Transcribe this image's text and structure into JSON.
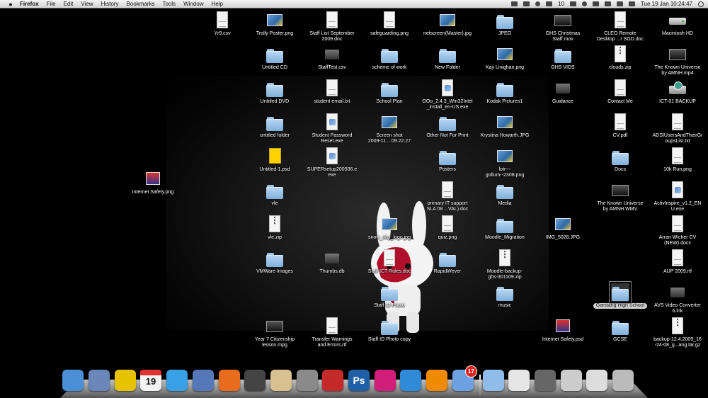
{
  "menubar": {
    "app_name": "Firefox",
    "menus": [
      "File",
      "Edit",
      "View",
      "History",
      "Bookmarks",
      "Tools",
      "Window",
      "Help"
    ],
    "status": {
      "badge_count": "10",
      "clock": "Tue 19 Jan  10:24:47"
    }
  },
  "desktop": {
    "items": [
      {
        "label": "Yr9.csv",
        "type": "doc"
      },
      {
        "label": "Trolly Poster.png",
        "type": "image"
      },
      {
        "label": "Staff List September\n2009.doc",
        "type": "doc"
      },
      {
        "label": "safeguarding.png",
        "type": "doc"
      },
      {
        "label": "netscreen(Master).jpg",
        "type": "image"
      },
      {
        "label": "JPEG",
        "type": "folder"
      },
      {
        "label": "GHS Christmas\nStaff.mov",
        "type": "video"
      },
      {
        "label": "CLEO Remote\nDesktop ...r SGD.doc",
        "type": "doc"
      },
      {
        "label": "Macintosh HD",
        "type": "drive"
      },
      {
        "label": "Untitled CD",
        "type": "folder"
      },
      {
        "label": "StaffTest.csv",
        "type": "dark"
      },
      {
        "label": "scheme of work",
        "type": "folder"
      },
      {
        "label": "New Folder",
        "type": "folder"
      },
      {
        "label": "Kay Linighan.png",
        "type": "image"
      },
      {
        "label": "GHS VIDS",
        "type": "folder"
      },
      {
        "label": "clouds.zip",
        "type": "zip"
      },
      {
        "label": "The Known Universe\nby AMNH.mp4",
        "type": "video"
      },
      {
        "label": "Untitled DVD",
        "type": "folder"
      },
      {
        "label": "student email.txt",
        "type": "doc"
      },
      {
        "label": "School Plan",
        "type": "folder"
      },
      {
        "label": "OOo_2.4.3_Win32Intel\n_install_en-US.exe",
        "type": "exe"
      },
      {
        "label": "Kodak Pictures1",
        "type": "folder"
      },
      {
        "label": "Guidance",
        "type": "dark"
      },
      {
        "label": "Contact Me",
        "type": "doc"
      },
      {
        "label": "ICT-01 BACKUP",
        "type": "backup"
      },
      {
        "label": "untitled folder",
        "type": "folder"
      },
      {
        "label": "Student Password\nReset.exe",
        "type": "exe"
      },
      {
        "label": "Screen shot\n2009-11... 09.22.27",
        "type": "image"
      },
      {
        "label": "Other Not For Print",
        "type": "folder"
      },
      {
        "label": "Krystina Howarth.JPG",
        "type": "image"
      },
      {
        "label": "CV.pdf",
        "type": "doc"
      },
      {
        "label": "ADSIUsersAndTheirGr\noupsList.txt",
        "type": "doc"
      },
      {
        "label": "Internet Safety.png",
        "type": "app"
      },
      {
        "label": "Untitled-1.psd",
        "type": "psd"
      },
      {
        "label": "SUPERsetup200936.e\nexe",
        "type": "exe"
      },
      {
        "label": "Posters",
        "type": "folder"
      },
      {
        "label": "lotr---\ngollum--2308.png",
        "type": "image"
      },
      {
        "label": "Docs",
        "type": "folder"
      },
      {
        "label": "10k Run.png",
        "type": "doc"
      },
      {
        "label": "vle",
        "type": "folder"
      },
      {
        "label": "primary IT support\nSLA 08 ...VAL).doc",
        "type": "doc"
      },
      {
        "label": "Media",
        "type": "folder"
      },
      {
        "label": "The Known Universe\nby AMNH.WMV",
        "type": "video"
      },
      {
        "label": "ActivInspire_v1.2_EN\nU.exe",
        "type": "exe"
      },
      {
        "label": "vle.zip",
        "type": "zip"
      },
      {
        "label": "snow_day_logo.jpg",
        "type": "image"
      },
      {
        "label": "quiz.png",
        "type": "doc"
      },
      {
        "label": "Moodle_Migration",
        "type": "folder"
      },
      {
        "label": "IMG_5028.JPG",
        "type": "image"
      },
      {
        "label": "Arran Wicher CV\n(NEW).docx",
        "type": "doc"
      },
      {
        "label": "VMWare Images",
        "type": "folder"
      },
      {
        "label": "Thumbs.db",
        "type": "dark"
      },
      {
        "label": "Staff ICT Rules.doc",
        "type": "doc"
      },
      {
        "label": "RapidWever",
        "type": "folder"
      },
      {
        "label": "Moodle-backup-\nghs-301109.zip",
        "type": "zip"
      },
      {
        "label": "AUP 2009.rtf",
        "type": "doc"
      },
      {
        "label": "Staff ID Photo",
        "type": "folder"
      },
      {
        "label": "music",
        "type": "folder"
      },
      {
        "label": "Garstang High School",
        "type": "folder",
        "selected": true
      },
      {
        "label": "AVS Video Converter\n6.lnk",
        "type": "dark"
      },
      {
        "label": "Year 7 Citizenship\nlesson.mpg",
        "type": "video"
      },
      {
        "label": "Transfer Warnings\nand Errors.rtf",
        "type": "doc"
      },
      {
        "label": "Staff ID Photo copy",
        "type": "folder"
      },
      {
        "label": "Internet Safety.psd",
        "type": "app"
      },
      {
        "label": "GCSE",
        "type": "folder"
      },
      {
        "label": "backup-12.4.2009_16\n-24-08_g...ang.tar.gz",
        "type": "zip"
      }
    ]
  },
  "dock": {
    "calendar_day": "19",
    "mail_badge": "17",
    "items": [
      {
        "name": "finder",
        "color": "#4a8fd8"
      },
      {
        "name": "preview",
        "color": "#6b86b8"
      },
      {
        "name": "adium",
        "color": "#e6c200"
      },
      {
        "name": "ical",
        "color": "#f2f2f2"
      },
      {
        "name": "itunes",
        "color": "#3aa0e6"
      },
      {
        "name": "dvd-player",
        "color": "#5678b8"
      },
      {
        "name": "firefox",
        "color": "#e86c1c"
      },
      {
        "name": "iphoto",
        "color": "#444444"
      },
      {
        "name": "textedit",
        "color": "#d9c090"
      },
      {
        "name": "system-preferences",
        "color": "#8a8a8a"
      },
      {
        "name": "parallels",
        "color": "#c42a2a"
      },
      {
        "name": "photoshop",
        "color": "#1f5fa8"
      },
      {
        "name": "istat",
        "color": "#d01e7a"
      },
      {
        "name": "wifi-app",
        "color": "#2f8ad8"
      },
      {
        "name": "vlc",
        "color": "#f08a00"
      },
      {
        "name": "mail",
        "color": "#6ca0e0"
      },
      {
        "name": "folder-downloads",
        "color": "#8fbce8"
      },
      {
        "name": "folder-documents",
        "color": "#e6e6e6"
      },
      {
        "name": "stack-a",
        "color": "#666666"
      },
      {
        "name": "stack-b",
        "color": "#cccccc"
      },
      {
        "name": "stack-c",
        "color": "#dddddd"
      },
      {
        "name": "trash",
        "color": "#bbbbbb"
      }
    ]
  }
}
